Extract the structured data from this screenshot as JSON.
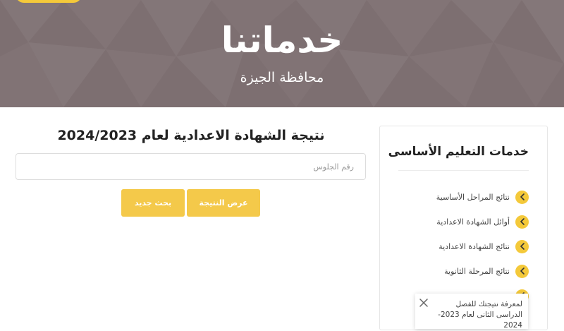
{
  "header": {
    "title": "خدماتنا",
    "subtitle": "محافظة الجيزة"
  },
  "main": {
    "title": "نتيجة الشهادة الاعدادية لعام 2024/2023",
    "seat_placeholder": "رقم الجلوس",
    "show_result_label": "عرض النتيجة",
    "new_search_label": "بحث جديد"
  },
  "sidebar": {
    "title": "خدمات التعليم الأساسى",
    "items": [
      {
        "label": "نتائج المراحل الأساسية"
      },
      {
        "label": "أوائل الشهادة الاعدادية"
      },
      {
        "label": "نتائج الشهادة الاعدادية"
      },
      {
        "label": "نتائج المرحلة الثانوية"
      }
    ]
  },
  "toast": {
    "text": "لمعرفة نتيجتك للفصل الدراسى الثانى لعام 2023-2024"
  },
  "colors": {
    "header_bg": "#7d6f71",
    "accent": "#f4c93a",
    "button": "#f4c94a"
  }
}
